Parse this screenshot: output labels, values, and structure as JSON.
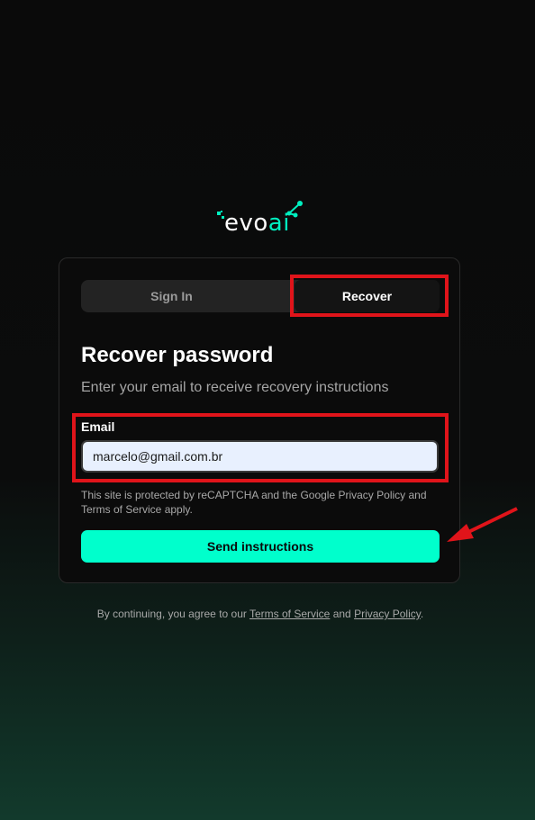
{
  "logo": {
    "part1": "evo",
    "part2": "ai",
    "accent_color": "#00f0c0"
  },
  "tabs": {
    "sign_in": "Sign In",
    "recover": "Recover",
    "active": "Recover"
  },
  "recover": {
    "heading": "Recover password",
    "subheading": "Enter your email to receive recovery instructions",
    "email_label": "Email",
    "email_value": "marcelo@gmail.com.br",
    "recaptcha_notice": "This site is protected by reCAPTCHA and the Google Privacy Policy and Terms of Service apply.",
    "submit_label": "Send instructions",
    "button_color": "#00ffcc"
  },
  "footer": {
    "prefix": "By continuing, you agree to our",
    "terms_link": "Terms of Service",
    "conjunction": "and",
    "privacy_link": "Privacy Policy",
    "suffix": "."
  },
  "annotations": {
    "highlight_color": "#e0141a"
  }
}
